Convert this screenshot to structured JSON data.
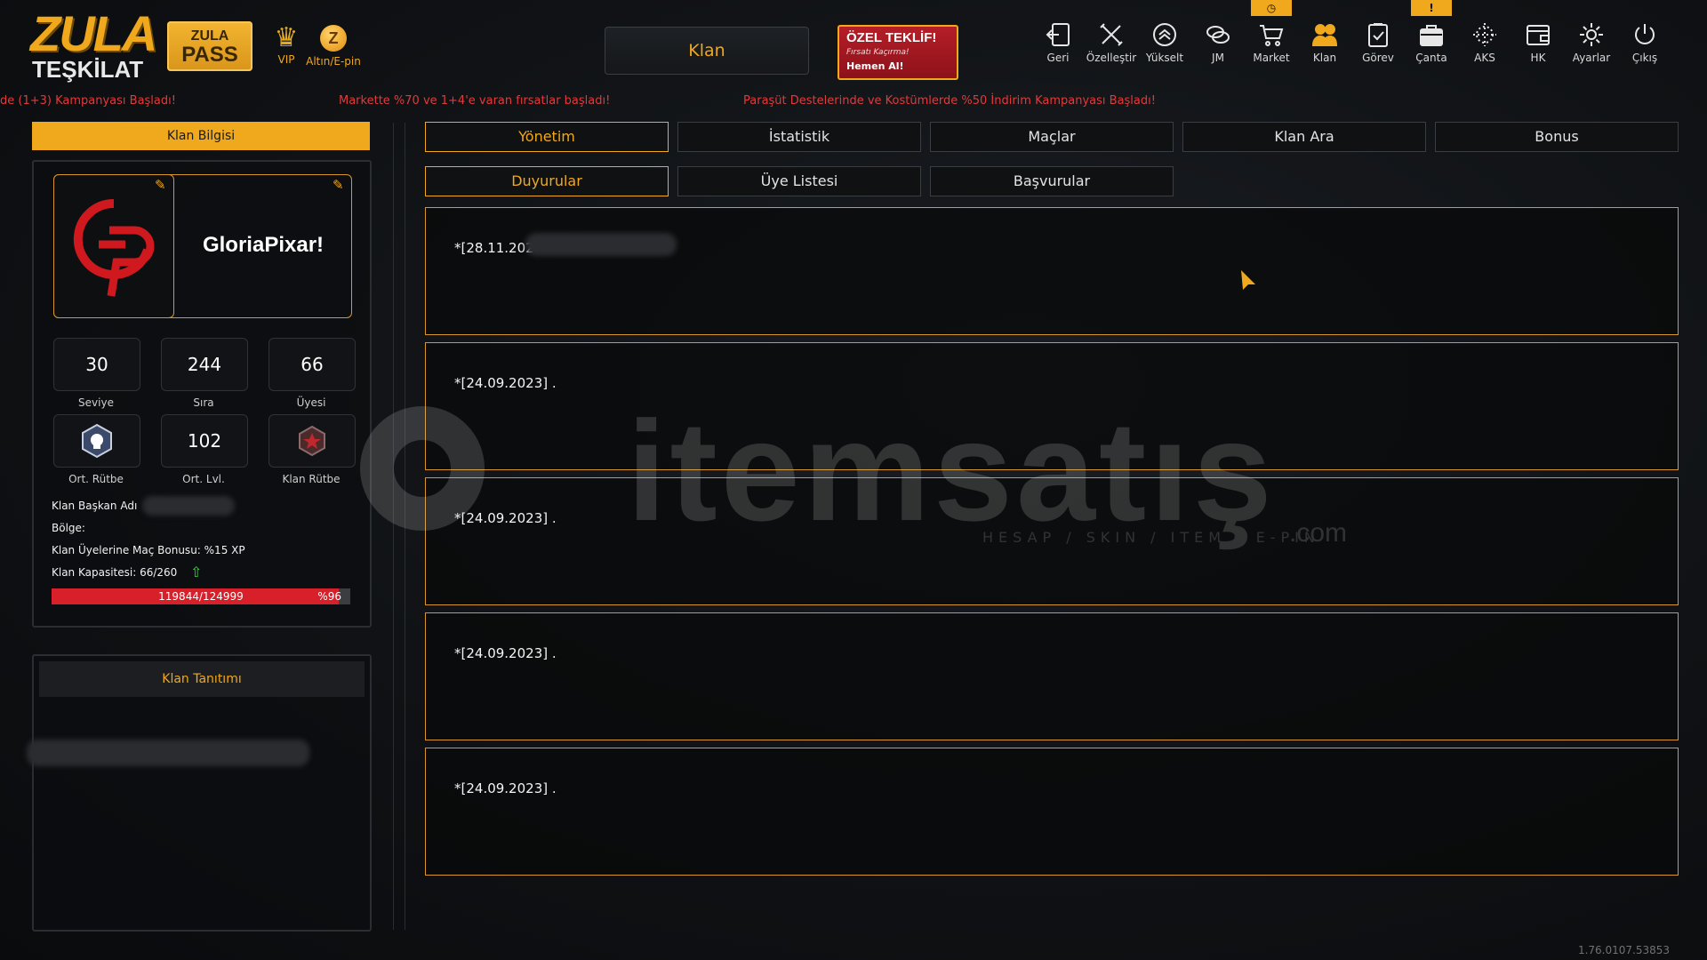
{
  "logo": {
    "line1": "ZULA",
    "line2": "TEŞKİLAT"
  },
  "pass_button": {
    "line1": "ZULA",
    "line2": "PASS"
  },
  "vip": {
    "label": "VIP",
    "icon": "laurel-crown-icon"
  },
  "altin": {
    "label": "Altın/E-pin",
    "coin": "Z",
    "icon": "gold-coin-icon"
  },
  "screen_title": "Klan",
  "offer": {
    "title": "ÖZEL TEKLİF!",
    "subtitle": "Fırsatı Kaçırma!",
    "cta": "Hemen Al!"
  },
  "nav": [
    {
      "label": "Geri",
      "icon": "back-icon"
    },
    {
      "label": "Özelleştir",
      "icon": "tools-icon"
    },
    {
      "label": "Yükselt",
      "icon": "upgrade-icon"
    },
    {
      "label": "JM",
      "icon": "coins-icon"
    },
    {
      "label": "Market",
      "icon": "cart-icon",
      "badge": "◷"
    },
    {
      "label": "Klan",
      "icon": "clan-users-icon"
    },
    {
      "label": "Görev",
      "icon": "clipboard-icon"
    },
    {
      "label": "Çanta",
      "icon": "bag-icon",
      "badge": "!"
    },
    {
      "label": "AKS",
      "icon": "crosshair-icon"
    },
    {
      "label": "HK",
      "icon": "wallet-icon"
    },
    {
      "label": "Ayarlar",
      "icon": "gear-icon"
    },
    {
      "label": "Çıkış",
      "icon": "power-icon"
    }
  ],
  "ticker": [
    "de (1+3) Kampanyası Başladı!",
    "Markette %70 ve 1+4'e varan fırsatlar başladı!",
    "Paraşüt Destelerinde ve Kostümlerde %50 İndirim Kampanyası Başladı!"
  ],
  "klan_bilgisi": {
    "header": "Klan Bilgisi",
    "clan_name": "GloriaPixar!",
    "stats": [
      {
        "value": "30",
        "label": "Seviye"
      },
      {
        "value": "244",
        "label": "Sıra"
      },
      {
        "value": "66",
        "label": "Üyesi"
      },
      {
        "value": "",
        "label": "Ort. Rütbe",
        "icon": "skull-rank-icon"
      },
      {
        "value": "102",
        "label": "Ort. Lvl."
      },
      {
        "value": "",
        "label": "Klan Rütbe",
        "icon": "star-rank-icon"
      }
    ],
    "lines": {
      "baskan": "Klan Başkan Adı",
      "bolge": "Bölge:",
      "bonus": "Klan Üyelerine Maç Bonusu: %15 XP",
      "kapasite": "Klan Kapasitesi: 66/260"
    },
    "progress": {
      "text": "119844/124999",
      "percent_label": "%96",
      "fraction": 0.96
    }
  },
  "tanitim": {
    "header": "Klan Tanıtımı"
  },
  "tabs_row1": [
    {
      "label": "Yönetim",
      "active": true
    },
    {
      "label": "İstatistik",
      "active": false
    },
    {
      "label": "Maçlar",
      "active": false
    },
    {
      "label": "Klan Ara",
      "active": false
    },
    {
      "label": "Bonus",
      "active": false
    }
  ],
  "tabs_row2": [
    {
      "label": "Duyurular",
      "active": true
    },
    {
      "label": "Üye Listesi",
      "active": false
    },
    {
      "label": "Başvurular",
      "active": false
    }
  ],
  "announcements": [
    "*[28.11.202",
    "*[24.09.2023] .",
    "*[24.09.2023] .",
    "*[24.09.2023] .",
    "*[24.09.2023] ."
  ],
  "watermark": {
    "brand": "itemsatış",
    "tagline": "HESAP / SKIN / ITEM / E-PIN",
    "suffix": ".com"
  },
  "version": "1.76.0107.53853",
  "colors": {
    "accent": "#f0a81c",
    "ticker": "#e23a3a",
    "progress": "#d8202a"
  }
}
